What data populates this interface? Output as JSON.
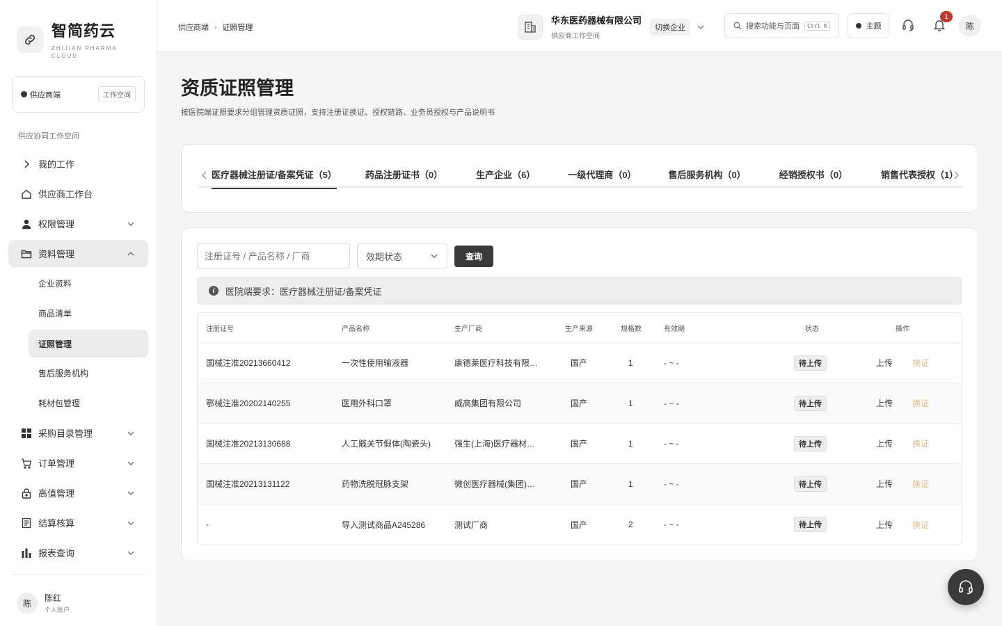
{
  "brand": {
    "name": "智简药云",
    "sub": "ZHIJIAN PHARMA CLOUD"
  },
  "workspace": {
    "label": "供应商端",
    "button": "工作空间"
  },
  "sidebar": {
    "section_title": "供应协同工作空间",
    "items": [
      {
        "label": "我的工作",
        "icon": "chevron-right-icon"
      },
      {
        "label": "供应商工作台",
        "icon": "home-icon"
      },
      {
        "label": "权限管理",
        "icon": "user-icon"
      },
      {
        "label": "资料管理",
        "icon": "folder-icon"
      },
      {
        "label": "采购目录管理",
        "icon": "grid-icon"
      },
      {
        "label": "订单管理",
        "icon": "cart-icon"
      },
      {
        "label": "高值管理",
        "icon": "lock-icon"
      },
      {
        "label": "结算核算",
        "icon": "receipt-icon"
      },
      {
        "label": "报表查询",
        "icon": "bar-chart-icon"
      }
    ],
    "sub_items": [
      {
        "label": "企业资料"
      },
      {
        "label": "商品清单"
      },
      {
        "label": "证照管理"
      },
      {
        "label": "售后服务机构"
      },
      {
        "label": "耗材包管理"
      }
    ]
  },
  "user": {
    "avatar": "陈",
    "name": "陈红",
    "sub": "个人账户"
  },
  "header": {
    "breadcrumb": [
      "供应商端",
      "证照管理"
    ],
    "company_name": "华东医药器械有限公司",
    "company_sub": "供应商工作空间",
    "switch_label": "切换企业",
    "search_placeholder": "搜索功能与页面",
    "search_shortcut": "Ctrl K",
    "theme_label": "主题",
    "notification_count": "1",
    "avatar": "陈"
  },
  "page": {
    "title": "资质证照管理",
    "description": "按医院端证照要求分组管理资质证照，支持注册证换证、授权链路、业务员授权与产品说明书"
  },
  "tabs": [
    {
      "label": "医疗器械注册证/备案凭证（5）"
    },
    {
      "label": "药品注册证书（0）"
    },
    {
      "label": "生产企业（6）"
    },
    {
      "label": "一级代理商（0）"
    },
    {
      "label": "售后服务机构（0）"
    },
    {
      "label": "经销授权书（0）"
    },
    {
      "label": "销售代表授权（1）"
    }
  ],
  "filters": {
    "keyword_placeholder": "注册证号 / 产品名称 / 厂商",
    "status_select": "效期状态",
    "query_button": "查询"
  },
  "notice": {
    "icon": "i",
    "text": "医院端要求：医疗器械注册证/备案凭证"
  },
  "table": {
    "headers": {
      "reg_no": "注册证号",
      "product": "产品名称",
      "maker": "生产厂商",
      "origin": "生产来源",
      "specs": "规格数",
      "validity": "有效期",
      "status": "状态",
      "action": "操作"
    },
    "rows": [
      {
        "reg_no": "国械注准20213660412",
        "product": "一次性使用输液器",
        "maker": "康德莱医疗科技有限…",
        "origin": "国产",
        "specs": "1",
        "validity": "- ~ -",
        "status": "待上传",
        "upload": "上传",
        "renew": "换证"
      },
      {
        "reg_no": "鄂械注准20202140255",
        "product": "医用外科口罩",
        "maker": "威高集团有限公司",
        "origin": "国产",
        "specs": "1",
        "validity": "- ~ -",
        "status": "待上传",
        "upload": "上传",
        "renew": "换证"
      },
      {
        "reg_no": "国械注准20213130688",
        "product": "人工髋关节假体(陶瓷头)",
        "maker": "强生(上海)医疗器材…",
        "origin": "国产",
        "specs": "1",
        "validity": "- ~ -",
        "status": "待上传",
        "upload": "上传",
        "renew": "换证"
      },
      {
        "reg_no": "国械注准20213131122",
        "product": "药物洗脱冠脉支架",
        "maker": "微创医疗器械(集团)…",
        "origin": "国产",
        "specs": "1",
        "validity": "- ~ -",
        "status": "待上传",
        "upload": "上传",
        "renew": "换证"
      },
      {
        "reg_no": "-",
        "product": "导入测试商品A245286",
        "maker": "测试厂商",
        "origin": "国产",
        "specs": "2",
        "validity": "- ~ -",
        "status": "待上传",
        "upload": "上传",
        "renew": "换证"
      }
    ]
  },
  "colors": {
    "accent": "#3a3a3a",
    "renew_link": "#e8b98a",
    "badge": "#c0392b"
  }
}
